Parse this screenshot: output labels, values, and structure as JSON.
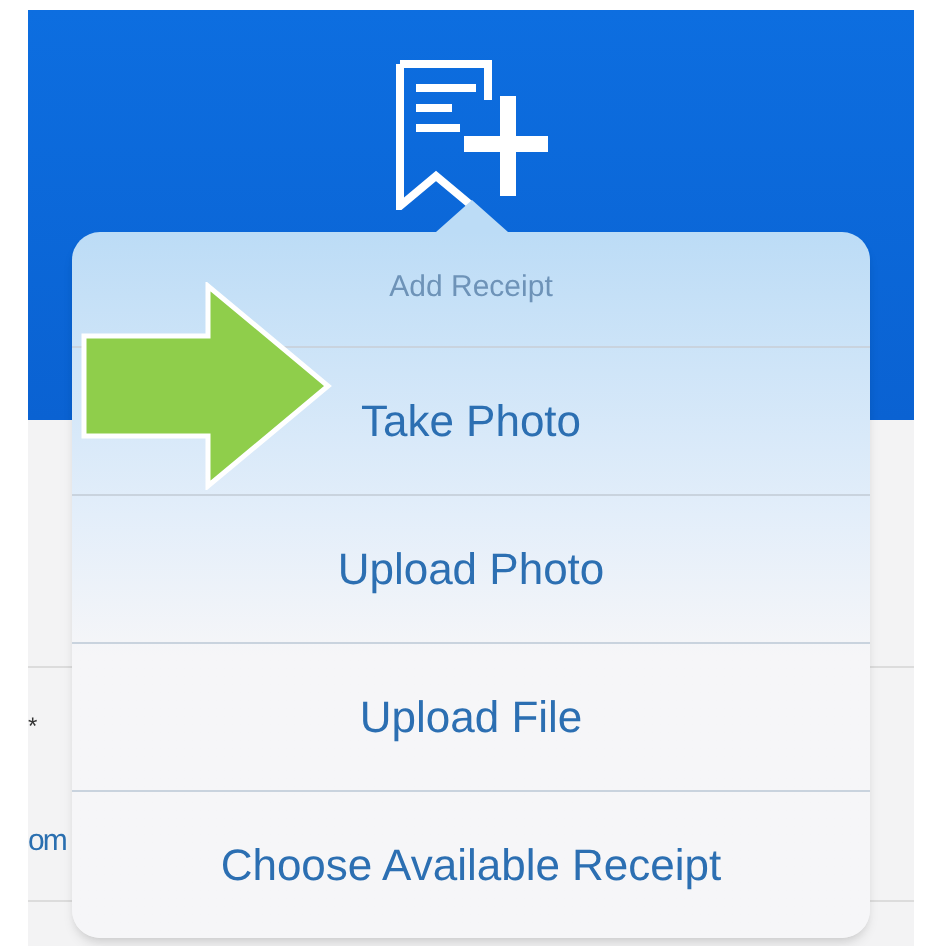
{
  "background_rows": [
    {
      "text": "*"
    },
    {
      "text": "om"
    }
  ],
  "popover": {
    "title": "Add Receipt",
    "options": [
      {
        "label": "Take Photo"
      },
      {
        "label": "Upload Photo"
      },
      {
        "label": "Upload File"
      },
      {
        "label": "Choose Available Receipt"
      }
    ]
  }
}
